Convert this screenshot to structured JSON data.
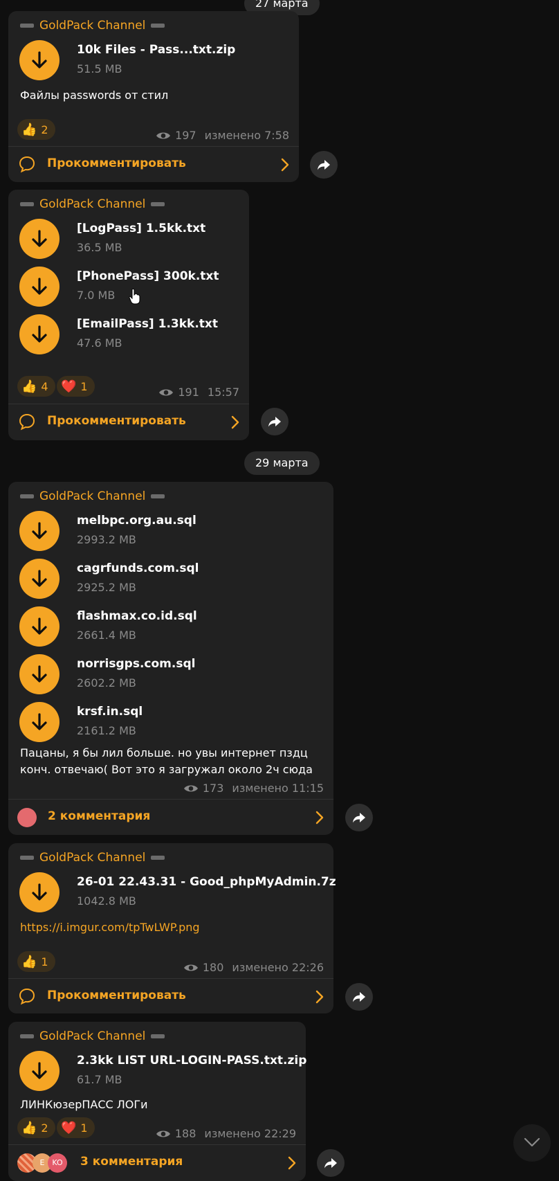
{
  "dates": [
    "27 марта",
    "29 марта"
  ],
  "channel_name": "GoldPack Channel",
  "comment_label": "Прокомментировать",
  "posts": [
    {
      "files": [
        {
          "name": "10k Files - Pass...txt.zip",
          "size": "51.5 MB"
        }
      ],
      "text": "Файлы passwords от стил",
      "reactions": [
        {
          "emoji": "👍",
          "count": "2"
        }
      ],
      "views": "197",
      "time": "изменено 7:58"
    },
    {
      "files": [
        {
          "name": "[LogPass] 1.5kk.txt",
          "size": "36.5 MB"
        },
        {
          "name": "[PhonePass] 300k.txt",
          "size": "7.0 MB"
        },
        {
          "name": "[EmailPass] 1.3kk.txt",
          "size": "47.6 MB"
        }
      ],
      "reactions": [
        {
          "emoji": "👍",
          "count": "4"
        },
        {
          "emoji": "❤️",
          "count": "1"
        }
      ],
      "views": "191",
      "time": "15:57"
    },
    {
      "files": [
        {
          "name": "melbpc.org.au.sql",
          "size": "2993.2 MB"
        },
        {
          "name": "cagrfunds.com.sql",
          "size": "2925.2 MB"
        },
        {
          "name": "flashmax.co.id.sql",
          "size": "2661.4 MB"
        },
        {
          "name": "norrisgps.com.sql",
          "size": "2602.2 MB"
        },
        {
          "name": "krsf.in.sql",
          "size": "2161.2 MB"
        }
      ],
      "text_lines": [
        "Пацаны, я бы лил больше. но увы интернет пздц",
        "конч. отвечаю( Вот это я загружал около 2ч сюда"
      ],
      "views": "173",
      "time": "изменено 11:15",
      "comments_label": "2 комментария"
    },
    {
      "files": [
        {
          "name": "26-01 22.43.31 - Good_phpMyAdmin.7z",
          "size": "1042.8 MB"
        }
      ],
      "link": "https://i.imgur.com/tpTwLWP.png",
      "reactions": [
        {
          "emoji": "👍",
          "count": "1"
        }
      ],
      "views": "180",
      "time": "изменено 22:26"
    },
    {
      "files": [
        {
          "name": "2.3kk LIST URL-LOGIN-PASS.txt.zip",
          "size": "61.7 MB"
        }
      ],
      "text": "ЛИНКюзерПАСС ЛОГи",
      "reactions": [
        {
          "emoji": "👍",
          "count": "2"
        },
        {
          "emoji": "❤️",
          "count": "1"
        }
      ],
      "views": "188",
      "time": "изменено 22:29",
      "comments_label": "3 комментария",
      "avatars": [
        "",
        "E",
        "KO"
      ]
    }
  ],
  "colors": {
    "accent": "#f5a524",
    "bubble": "#212121",
    "background": "#0f0f0f"
  }
}
